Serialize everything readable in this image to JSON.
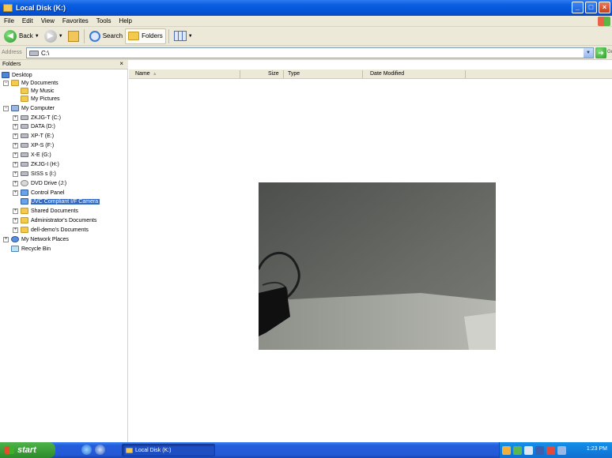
{
  "window": {
    "title": "Local Disk (K:)",
    "buttons": {
      "minimize": "_",
      "maximize": "□",
      "close": "×"
    }
  },
  "menu": [
    "File",
    "Edit",
    "View",
    "Favorites",
    "Tools",
    "Help"
  ],
  "toolbar": {
    "back_label": "Back",
    "search_label": "Search",
    "folders_label": "Folders"
  },
  "address": {
    "label": "Address",
    "value": "C:\\",
    "go_label": "Go"
  },
  "folders_pane": {
    "title": "Folders",
    "close_glyph": "×",
    "items": [
      {
        "label": "Desktop"
      },
      {
        "label": "My Documents"
      },
      {
        "label": "My Music"
      },
      {
        "label": "My Pictures"
      },
      {
        "label": "My Computer"
      },
      {
        "label": "ZKJG-T (C:)"
      },
      {
        "label": "DATA (D:)"
      },
      {
        "label": "XP-T (E:)"
      },
      {
        "label": "XP-S (F:)"
      },
      {
        "label": "X-E (G:)"
      },
      {
        "label": "ZKJG-I (H:)"
      },
      {
        "label": "SISS s (I:)"
      },
      {
        "label": "DVD Drive (J:)"
      },
      {
        "label": "Control Panel"
      },
      {
        "label": "UVC Compliant I/F Camera"
      },
      {
        "label": "Shared Documents"
      },
      {
        "label": "Administrator's Documents"
      },
      {
        "label": "dell-demo's Documents"
      },
      {
        "label": "My Network Places"
      },
      {
        "label": "Recycle Bin"
      }
    ]
  },
  "list": {
    "columns": [
      "Name",
      "Size",
      "Type",
      "Date Modified"
    ],
    "sort_glyph": "▲"
  },
  "taskbar": {
    "start_label": "start",
    "task_label": "Local Disk (K:)",
    "clock": "1:23 PM"
  },
  "colors": {
    "titlebar": "#0554d8",
    "selection": "#316ac5",
    "chrome": "#ece9d8",
    "start": "#2c8a2a"
  }
}
